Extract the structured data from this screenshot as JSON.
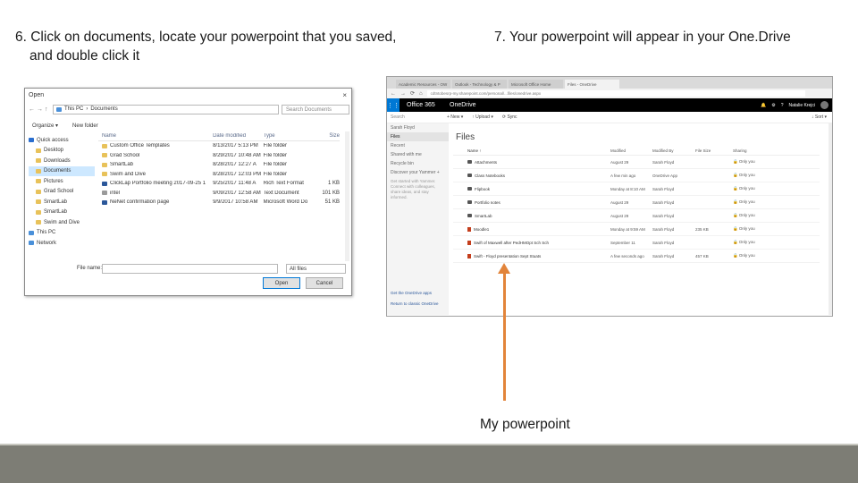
{
  "captions": {
    "step6_line1": "6. Click on documents, locate your powerpoint that you saved,",
    "step6_line2": "and double click it",
    "step7": "7. Your powerpoint will appear in your One.Drive",
    "arrow_label": "My powerpoint"
  },
  "open_dialog": {
    "title": "Open",
    "close_icon": "×",
    "breadcrumb": [
      "This PC",
      "Documents"
    ],
    "search_placeholder": "Search Documents",
    "organize": "Organize ▾",
    "new_folder": "New folder",
    "nav_items": [
      {
        "label": "Quick access",
        "icon": "star-icon",
        "indent": false
      },
      {
        "label": "Desktop",
        "icon": "folder-icon",
        "indent": true
      },
      {
        "label": "Downloads",
        "icon": "folder-icon",
        "indent": true
      },
      {
        "label": "Documents",
        "icon": "folder-icon",
        "indent": true,
        "selected": true
      },
      {
        "label": "Pictures",
        "icon": "folder-icon",
        "indent": true
      },
      {
        "label": "Grad School",
        "icon": "folder-icon",
        "indent": true
      },
      {
        "label": "SmartLab",
        "icon": "folder-icon",
        "indent": true
      },
      {
        "label": "SmartLab",
        "icon": "folder-icon",
        "indent": true
      },
      {
        "label": "Swim and Dive",
        "icon": "folder-icon",
        "indent": true
      },
      {
        "label": "This PC",
        "icon": "computer-icon",
        "indent": false
      },
      {
        "label": "Network",
        "icon": "network-icon",
        "indent": false
      }
    ],
    "columns": [
      "Name",
      "Date modified",
      "Type",
      "Size"
    ],
    "files": [
      {
        "name": "Custom Office Templates",
        "date": "8/13/2017 5:13 PM",
        "type": "File folder",
        "size": "",
        "kind": "folder"
      },
      {
        "name": "Grad School",
        "date": "8/29/2017 10:48 AM",
        "type": "File folder",
        "size": "",
        "kind": "folder"
      },
      {
        "name": "SmartLab",
        "date": "8/28/2017 12:27 A",
        "type": "File folder",
        "size": "",
        "kind": "folder"
      },
      {
        "name": "Swim and Dive",
        "date": "8/28/2017 12:03 PM",
        "type": "File folder",
        "size": "",
        "kind": "folder"
      },
      {
        "name": "ClickLap Portfolio meeting 2017-09-25 1",
        "date": "9/25/2017 11:48 A",
        "type": "Rich Text Format",
        "size": "1 KB",
        "kind": "doc"
      },
      {
        "name": "intel",
        "date": "9/09/2017 12:58 AM",
        "type": "Text Document",
        "size": "101 KB",
        "kind": "txt"
      },
      {
        "name": "NeNet confirmation page",
        "date": "9/9/2017 10:58 AM",
        "type": "Microsoft Word Do",
        "size": "51 KB",
        "kind": "doc"
      }
    ],
    "file_name_label": "File name:",
    "filter": "All files",
    "open_button": "Open",
    "cancel_button": "Cancel"
  },
  "browser": {
    "tabs": [
      "Academic Resources - OW",
      "Outlook - Technology & P",
      "Microsoft Office Home",
      "Files - OneDrive"
    ],
    "url": "cdtntobesrp-my.sharepoint.com/personal/...files/onedrive.aspx",
    "suite": "Office 365",
    "app": "OneDrive",
    "user": "Natalie Krejci",
    "search_placeholder": "Search",
    "commands": [
      "+ New ▾",
      "↑ Upload ▾",
      "⟳ Sync"
    ],
    "sort": "↓ Sort ▾",
    "nav": [
      {
        "label": "Sarah Floyd",
        "selected": false
      },
      {
        "label": "Files",
        "selected": true
      },
      {
        "label": "Recent",
        "selected": false
      },
      {
        "label": "Shared with me",
        "selected": false
      },
      {
        "label": "Recycle bin",
        "selected": false
      },
      {
        "label": "Discover your Yammer +",
        "selected": false
      }
    ],
    "promo": "Get started with Yammer. Connect with colleagues, share ideas, and stay informed.",
    "footer_links": [
      "Get the OneDrive apps",
      "Return to classic OneDrive"
    ],
    "files_title": "Files",
    "columns": [
      "Name ↑",
      "Modified",
      "Modified By",
      "File Size",
      "Sharing"
    ],
    "files": [
      {
        "name": "Attachments",
        "modified": "August 29",
        "by": "Sarah Floyd",
        "size": "",
        "sharing": "Only you",
        "kind": "folder"
      },
      {
        "name": "Class Notebooks",
        "modified": "A few min ago",
        "by": "OneDrive App",
        "size": "",
        "sharing": "Only you",
        "kind": "folder"
      },
      {
        "name": "Flipbook",
        "modified": "Monday at 8:10 AM",
        "by": "Sarah Floyd",
        "size": "",
        "sharing": "Only you",
        "kind": "folder"
      },
      {
        "name": "Portfolio notes",
        "modified": "August 29",
        "by": "Sarah Floyd",
        "size": "",
        "sharing": "Only you",
        "kind": "folder"
      },
      {
        "name": "SmartLab",
        "modified": "August 29",
        "by": "Sarah Floyd",
        "size": "",
        "sharing": "Only you",
        "kind": "folder"
      },
      {
        "name": "Moodle1",
        "modified": "Monday at 9:59 AM",
        "by": "Sarah Floyd",
        "size": "235 KB",
        "sharing": "Only you",
        "kind": "file"
      },
      {
        "name": "Swift of Maxwell after PedHMOpt Sch Sch",
        "modified": "September 11",
        "by": "Sarah Floyd",
        "size": "",
        "sharing": "Only you",
        "kind": "file"
      },
      {
        "name": "Swift - Floyd presentation Sept Stuats",
        "modified": "A few seconds ago",
        "by": "Sarah Floyd",
        "size": "457 KB",
        "sharing": "Only you",
        "kind": "file"
      }
    ]
  },
  "colors": {
    "arrow": "#e2843a",
    "office_blue": "#0078d4",
    "dialog_selected": "#cde8ff",
    "folder": "#e8c25a",
    "bottom_band": "#7d7d75"
  }
}
